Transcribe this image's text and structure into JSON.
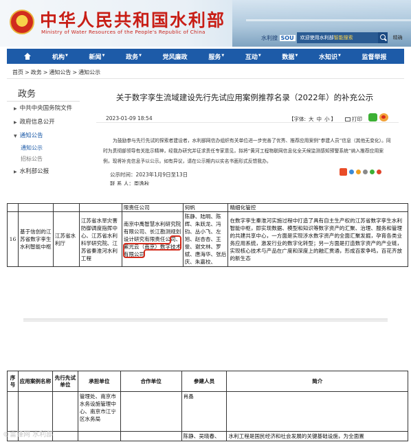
{
  "header": {
    "title": "中华人民共和国水利部",
    "subtitle": "Ministry of Water Resources of the People's Republic of China",
    "search_brand": "水利搜",
    "search_brand_badge": "SOU",
    "search_prefix": "欢迎使用水利部",
    "search_highlight": "智能搜索",
    "search_extra": "精确"
  },
  "nav": {
    "items": [
      {
        "label": "机构"
      },
      {
        "label": "新闻"
      },
      {
        "label": "政务"
      },
      {
        "label": "党风廉政"
      },
      {
        "label": "服务"
      },
      {
        "label": "互动"
      },
      {
        "label": "数据"
      },
      {
        "label": "水知识"
      },
      {
        "label": "监督举报"
      }
    ],
    "caret": "▼"
  },
  "breadcrumb": [
    "首页",
    "政务",
    "通知公告",
    "通知公示"
  ],
  "breadcrumb_sep": ">",
  "sidebar": {
    "title": "政务",
    "items": [
      {
        "label": "中共中央国务院文件"
      },
      {
        "label": "政府信息公开"
      },
      {
        "label": "通知公告"
      }
    ],
    "subitems": [
      {
        "label": "通知公示"
      },
      {
        "label": "招标公告"
      }
    ],
    "last_item": "水利部公报"
  },
  "article": {
    "title": "关于数字孪生流域建设先行先试应用案例推荐名录（2022年）的补充公示",
    "date": "2023-01-09 18:54",
    "font_label": "【字体:",
    "font_sizes": [
      "大",
      "中",
      "小"
    ],
    "font_close": "】",
    "print_label": "打印",
    "body": "为鼓励参与先行先试的探索者建设者，水利部网信办组织有关单位进一步完善了优秀、推荐应用案例“参建人员”信息（其他无变化）。同时为贯彻部领导有关批示精神，经我办研究并征求责任专家意见，拟将“黄河工程物联网信息化全天候监测感知预警系统”纳入推荐应用案例，现将补充信息予以公示。如有异议，请在公示期内以实名书面形式反馈我办。",
    "period": "公示时间：2023年1月9日至13日",
    "contact": "联 系 人：周逸秋"
  },
  "doc1": {
    "top_row": [
      "",
      "",
      "",
      "",
      "限责任公司",
      "何帆",
      "精细化管控"
    ],
    "row": {
      "num": "16",
      "name": "基于信创的江苏省数字孪生水利智能中枢",
      "unit": "江苏省水利厅",
      "lead": "江苏省水旱灾害防御调度指挥中心、江苏省水利科学研究院、江苏省秦淮河水利工程",
      "coop": [
        "南京中禹智慧水利研究院有限公司、长江勘测规划设计研究有限责任公",
        "司、紫光云（南京）数字技术有限公司"
      ],
      "people": "陈静、陆明、陈辉、朱跃龙、冯钧、丛小飞、左旭、赵杏杏、王俊、谢文林、罗斌、唐海华、张后庆、朱嘉校、",
      "desc": "在数字孪生秦淮河实施过程中打造了具有自主生产权的江苏省数字孪生水利智能中枢，即实现数据、模型和知识等数字资产的汇聚、治理、服务和管理的共建共享中心，一方面是实现涉水数字资产的全面汇聚发掘，孕育各类业务应用系统，激发行业的数字化转型；另一方面是打造数字资产的产业链，实现核心技术与产品在广度和深度上的融汇贯通，形成百家争鸣，百花齐放的新生态"
    }
  },
  "doc2": {
    "headers": [
      "序号",
      "应用案例名称",
      "先行先试单位",
      "承担单位",
      "合作单位",
      "参建人员",
      "简介"
    ],
    "row1": {
      "lead": "管理处、南京市水务设施管理中心、南京市江宁区水务局",
      "people": "肖晶"
    },
    "row2": {
      "people": "陈静、吴晓春、",
      "desc": "水利工程是国民经济和社会发展的关键基础设施，为全面置"
    }
  },
  "watermark": "©雷锋网 水利部"
}
